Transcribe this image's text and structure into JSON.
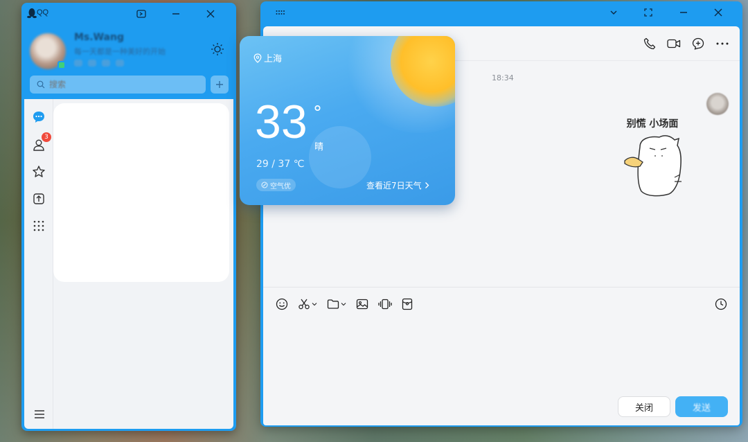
{
  "main_window": {
    "app_name": "QQ",
    "profile": {
      "nickname": "Ms.Wang",
      "signature": "每一天都是一种美好的开始"
    },
    "search": {
      "placeholder": "搜索"
    },
    "rail": {
      "contacts_badge": "3"
    }
  },
  "chat_window": {
    "timestamp": "18:34",
    "sticker_caption": "别慌 小场面",
    "buttons": {
      "close": "关闭",
      "send": "发送"
    }
  },
  "weather": {
    "location": "上海",
    "temperature": "33",
    "degree_symbol": "°",
    "condition": "晴",
    "range": "29 / 37 ℃",
    "air_quality": "空气优",
    "forecast_link": "查看近7日天气"
  },
  "colors": {
    "qq_blue": "#1e9cf0",
    "badge_red": "#f04a3c",
    "sun_yellow": "#ffbf2a"
  }
}
